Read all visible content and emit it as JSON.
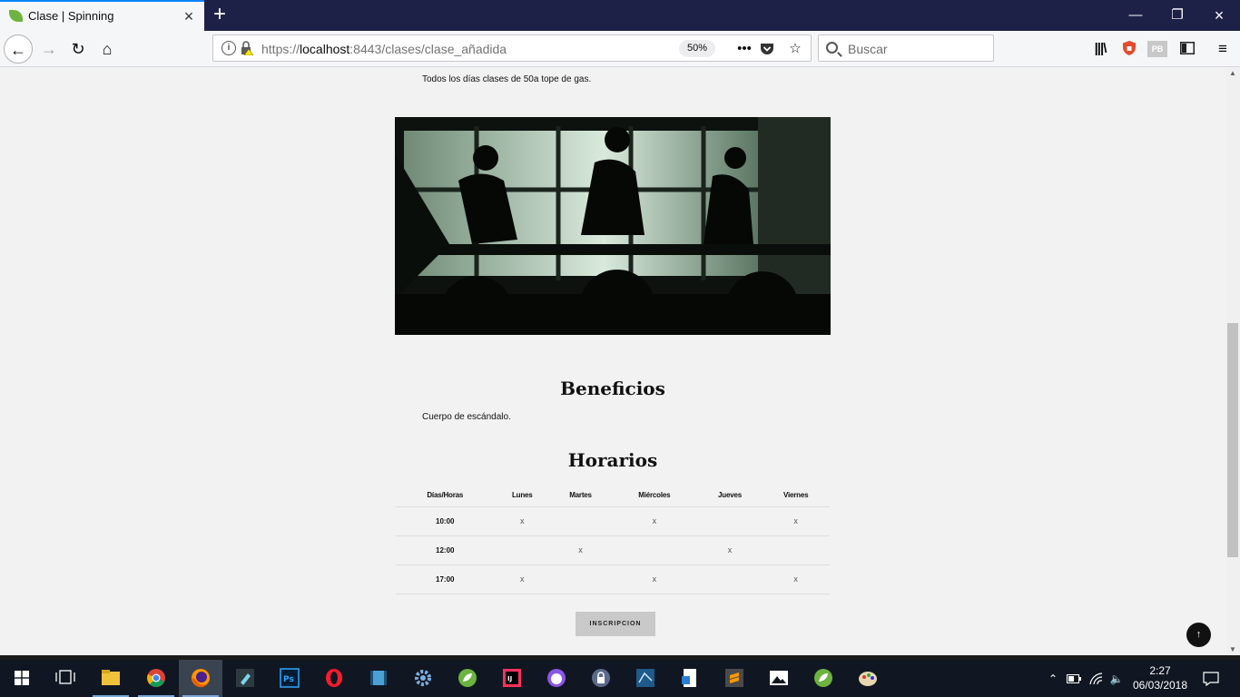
{
  "browser": {
    "tab_title": "Clase | Spinning",
    "url_prefix": "https://",
    "url_host": "localhost",
    "url_rest": ":8443/clases/clase_añadida",
    "zoom": "50%",
    "search_placeholder": "Buscar"
  },
  "page": {
    "description": "Todos los días clases de 50a tope de gas.",
    "benefits_title": "Beneficios",
    "benefits_text": "Cuerpo de escándalo.",
    "schedule_title": "Horarios",
    "schedule": {
      "headers": [
        "Días/Horas",
        "Lunes",
        "Martes",
        "Miércoles",
        "Jueves",
        "Viernes"
      ],
      "rows": [
        [
          "10:00",
          "x",
          "",
          "x",
          "",
          "x"
        ],
        [
          "12:00",
          "",
          "x",
          "",
          "x",
          ""
        ],
        [
          "17:00",
          "x",
          "",
          "x",
          "",
          "x"
        ]
      ]
    },
    "inscribe_label": "INSCRIPCION",
    "to_top_label": "↑"
  },
  "taskbar": {
    "time": "2:27",
    "date": "06/03/2018"
  },
  "colors": {
    "titlebar": "#1e2147",
    "accent": "#0a84ff",
    "spring_green": "#6db33f",
    "page_bg": "#f2f2f2"
  }
}
